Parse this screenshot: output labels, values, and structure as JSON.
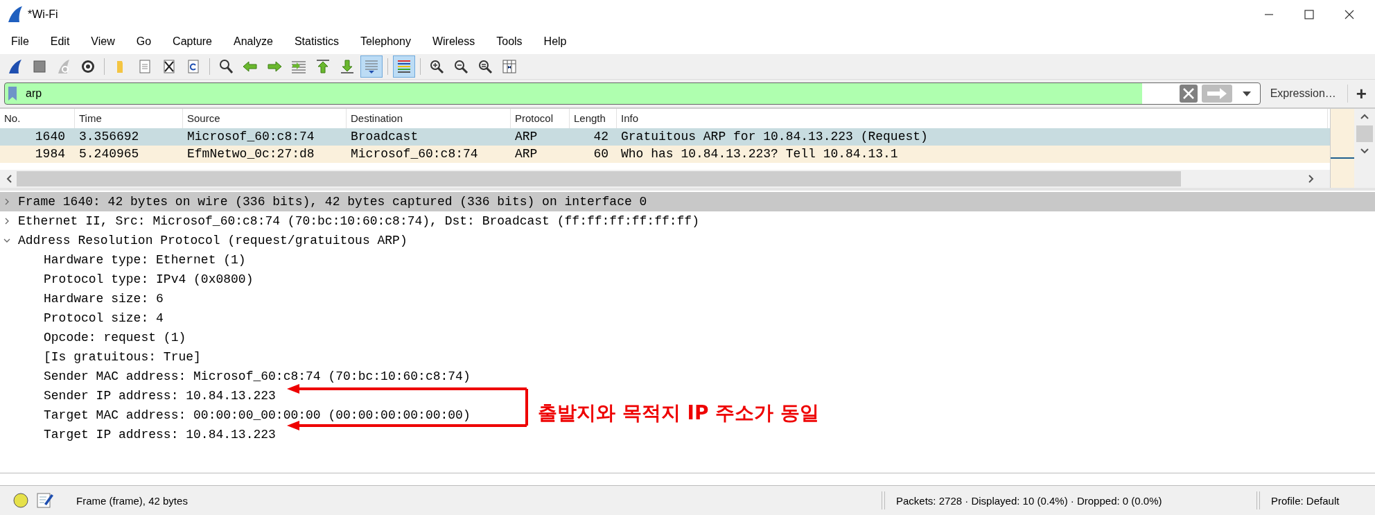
{
  "window": {
    "title": "*Wi-Fi"
  },
  "menu": [
    "File",
    "Edit",
    "View",
    "Go",
    "Capture",
    "Analyze",
    "Statistics",
    "Telephony",
    "Wireless",
    "Tools",
    "Help"
  ],
  "toolbar": [
    {
      "kind": "fin",
      "selected": false
    },
    {
      "kind": "stop",
      "selected": false
    },
    {
      "kind": "restart",
      "selected": false
    },
    {
      "kind": "gear",
      "selected": false
    },
    {
      "kind": "separator"
    },
    {
      "kind": "folder",
      "selected": false
    },
    {
      "kind": "file",
      "selected": false
    },
    {
      "kind": "close",
      "selected": false
    },
    {
      "kind": "reload",
      "selected": false
    },
    {
      "kind": "separator"
    },
    {
      "kind": "find",
      "selected": false
    },
    {
      "kind": "back",
      "selected": false
    },
    {
      "kind": "forward",
      "selected": false
    },
    {
      "kind": "goto",
      "selected": false
    },
    {
      "kind": "first",
      "selected": false
    },
    {
      "kind": "last",
      "selected": false
    },
    {
      "kind": "autoscroll",
      "selected": true
    },
    {
      "kind": "separator"
    },
    {
      "kind": "colorize",
      "selected": true
    },
    {
      "kind": "separator"
    },
    {
      "kind": "zoomin",
      "selected": false
    },
    {
      "kind": "zoomout",
      "selected": false
    },
    {
      "kind": "zoomreset",
      "selected": false
    },
    {
      "kind": "resize",
      "selected": false
    }
  ],
  "filter": {
    "value": "arp",
    "expression_button": "Expression…",
    "add_button": "+"
  },
  "packet_list": {
    "columns": [
      "No.",
      "Time",
      "Source",
      "Destination",
      "Protocol",
      "Length",
      "Info"
    ],
    "rows": [
      {
        "cells": [
          "1640",
          "3.356692",
          "Microsof_60:c8:74",
          "Broadcast",
          "ARP",
          "42",
          "Gratuitous ARP for 10.84.13.223 (Request)"
        ],
        "selected": true
      },
      {
        "cells": [
          "1984",
          "5.240965",
          "EfmNetwo_0c:27:d8",
          "Microsof_60:c8:74",
          "ARP",
          "60",
          "Who has 10.84.13.223? Tell 10.84.13.1"
        ],
        "selected": false
      }
    ]
  },
  "details": [
    {
      "text": "Frame 1640: 42 bytes on wire (336 bits), 42 bytes captured (336 bits) on interface 0",
      "expanded": false,
      "selected": true
    },
    {
      "text": "Ethernet II, Src: Microsof_60:c8:74 (70:bc:10:60:c8:74), Dst: Broadcast (ff:ff:ff:ff:ff:ff)",
      "expanded": false,
      "selected": false
    },
    {
      "text": "Address Resolution Protocol (request/gratuitous ARP)",
      "expanded": true,
      "selected": false,
      "children": [
        {
          "text": "Hardware type: Ethernet (1)",
          "selected": false
        },
        {
          "text": "Protocol type: IPv4 (0x0800)",
          "selected": false
        },
        {
          "text": "Hardware size: 6",
          "selected": false
        },
        {
          "text": "Protocol size: 4",
          "selected": false
        },
        {
          "text": "Opcode: request (1)",
          "selected": false
        },
        {
          "text": "[Is gratuitous: True]",
          "selected": false
        },
        {
          "text": "Sender MAC address: Microsof_60:c8:74 (70:bc:10:60:c8:74)",
          "selected": false
        },
        {
          "text": "Sender IP address: 10.84.13.223",
          "selected": false
        },
        {
          "text": "Target MAC address: 00:00:00_00:00:00 (00:00:00:00:00:00)",
          "selected": false
        },
        {
          "text": "Target IP address: 10.84.13.223",
          "selected": false
        }
      ]
    }
  ],
  "annotation": {
    "text": "출발지와 목적지 IP 주소가 동일"
  },
  "status_bar": {
    "frame": "Frame (frame), 42 bytes",
    "packets": "Packets: 2728 · Displayed: 10 (0.4%) · Dropped: 0 (0.0%)",
    "profile": "Profile: Default"
  }
}
